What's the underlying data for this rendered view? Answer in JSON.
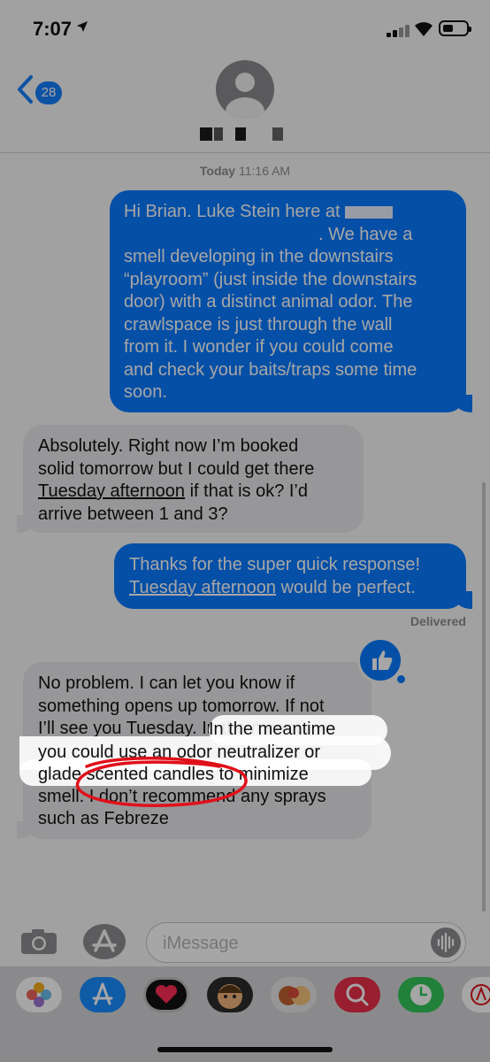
{
  "status_bar": {
    "time": "7:07"
  },
  "header": {
    "back_count": "28"
  },
  "conversation": {
    "timestamp_day": "Today",
    "timestamp_time": "11:16 AM",
    "messages": [
      {
        "from": "me",
        "text_before_redaction": "Hi Brian. Luke Stein here at",
        "text_after_redaction": ". We have a\nsmell developing in the downstairs\n“playroom” (just inside the downstairs\ndoor) with a distinct animal odor. The\ncrawlspace is just through the wall\nfrom it. I wonder if you could come\nand check your baits/traps some time\nsoon."
      },
      {
        "from": "them",
        "line1": "Absolutely. Right now I’m booked",
        "line2": "solid tomorrow but I could get there",
        "link": "Tuesday afternoon",
        "line3_rest": " if that is ok? I’d",
        "line4": "arrive between 1 and 3?"
      },
      {
        "from": "me",
        "line1": "Thanks for the super quick response!",
        "link": "Tuesday afternoon",
        "line2_rest": " would be perfect."
      },
      {
        "from": "them",
        "text": "No problem.  I can let you know if\nsomething opens up tomorrow. If not\nI’ll see you Tuesday. In the meantime\nyou could use an odor neutralizer or\nglade scented candles to minimize\nsmell. I don’t recommend any sprays\nsuch as Febreze"
      }
    ],
    "delivered_label": "Delivered",
    "tapback_icon": "thumbs-up-icon"
  },
  "input": {
    "placeholder": "iMessage"
  },
  "app_drawer": {
    "apps": [
      {
        "name": "photos-app",
        "color": "#ffffff"
      },
      {
        "name": "app-store-app",
        "color": "#1a8cff"
      },
      {
        "name": "digital-touch-app",
        "color": "#111111"
      },
      {
        "name": "memoji-app",
        "color": "#2b2b2b"
      },
      {
        "name": "memoji-stickers-app",
        "color": "#e7e7e7"
      },
      {
        "name": "images-search-app",
        "color": "#e8314b"
      },
      {
        "name": "clock-app",
        "color": "#34c759"
      },
      {
        "name": "more-app",
        "color": "#ffffff"
      }
    ]
  },
  "colors": {
    "sent_bubble": "#0a7aff",
    "received_bubble": "#e9e9eb",
    "annotation_circle": "#e0101a"
  }
}
